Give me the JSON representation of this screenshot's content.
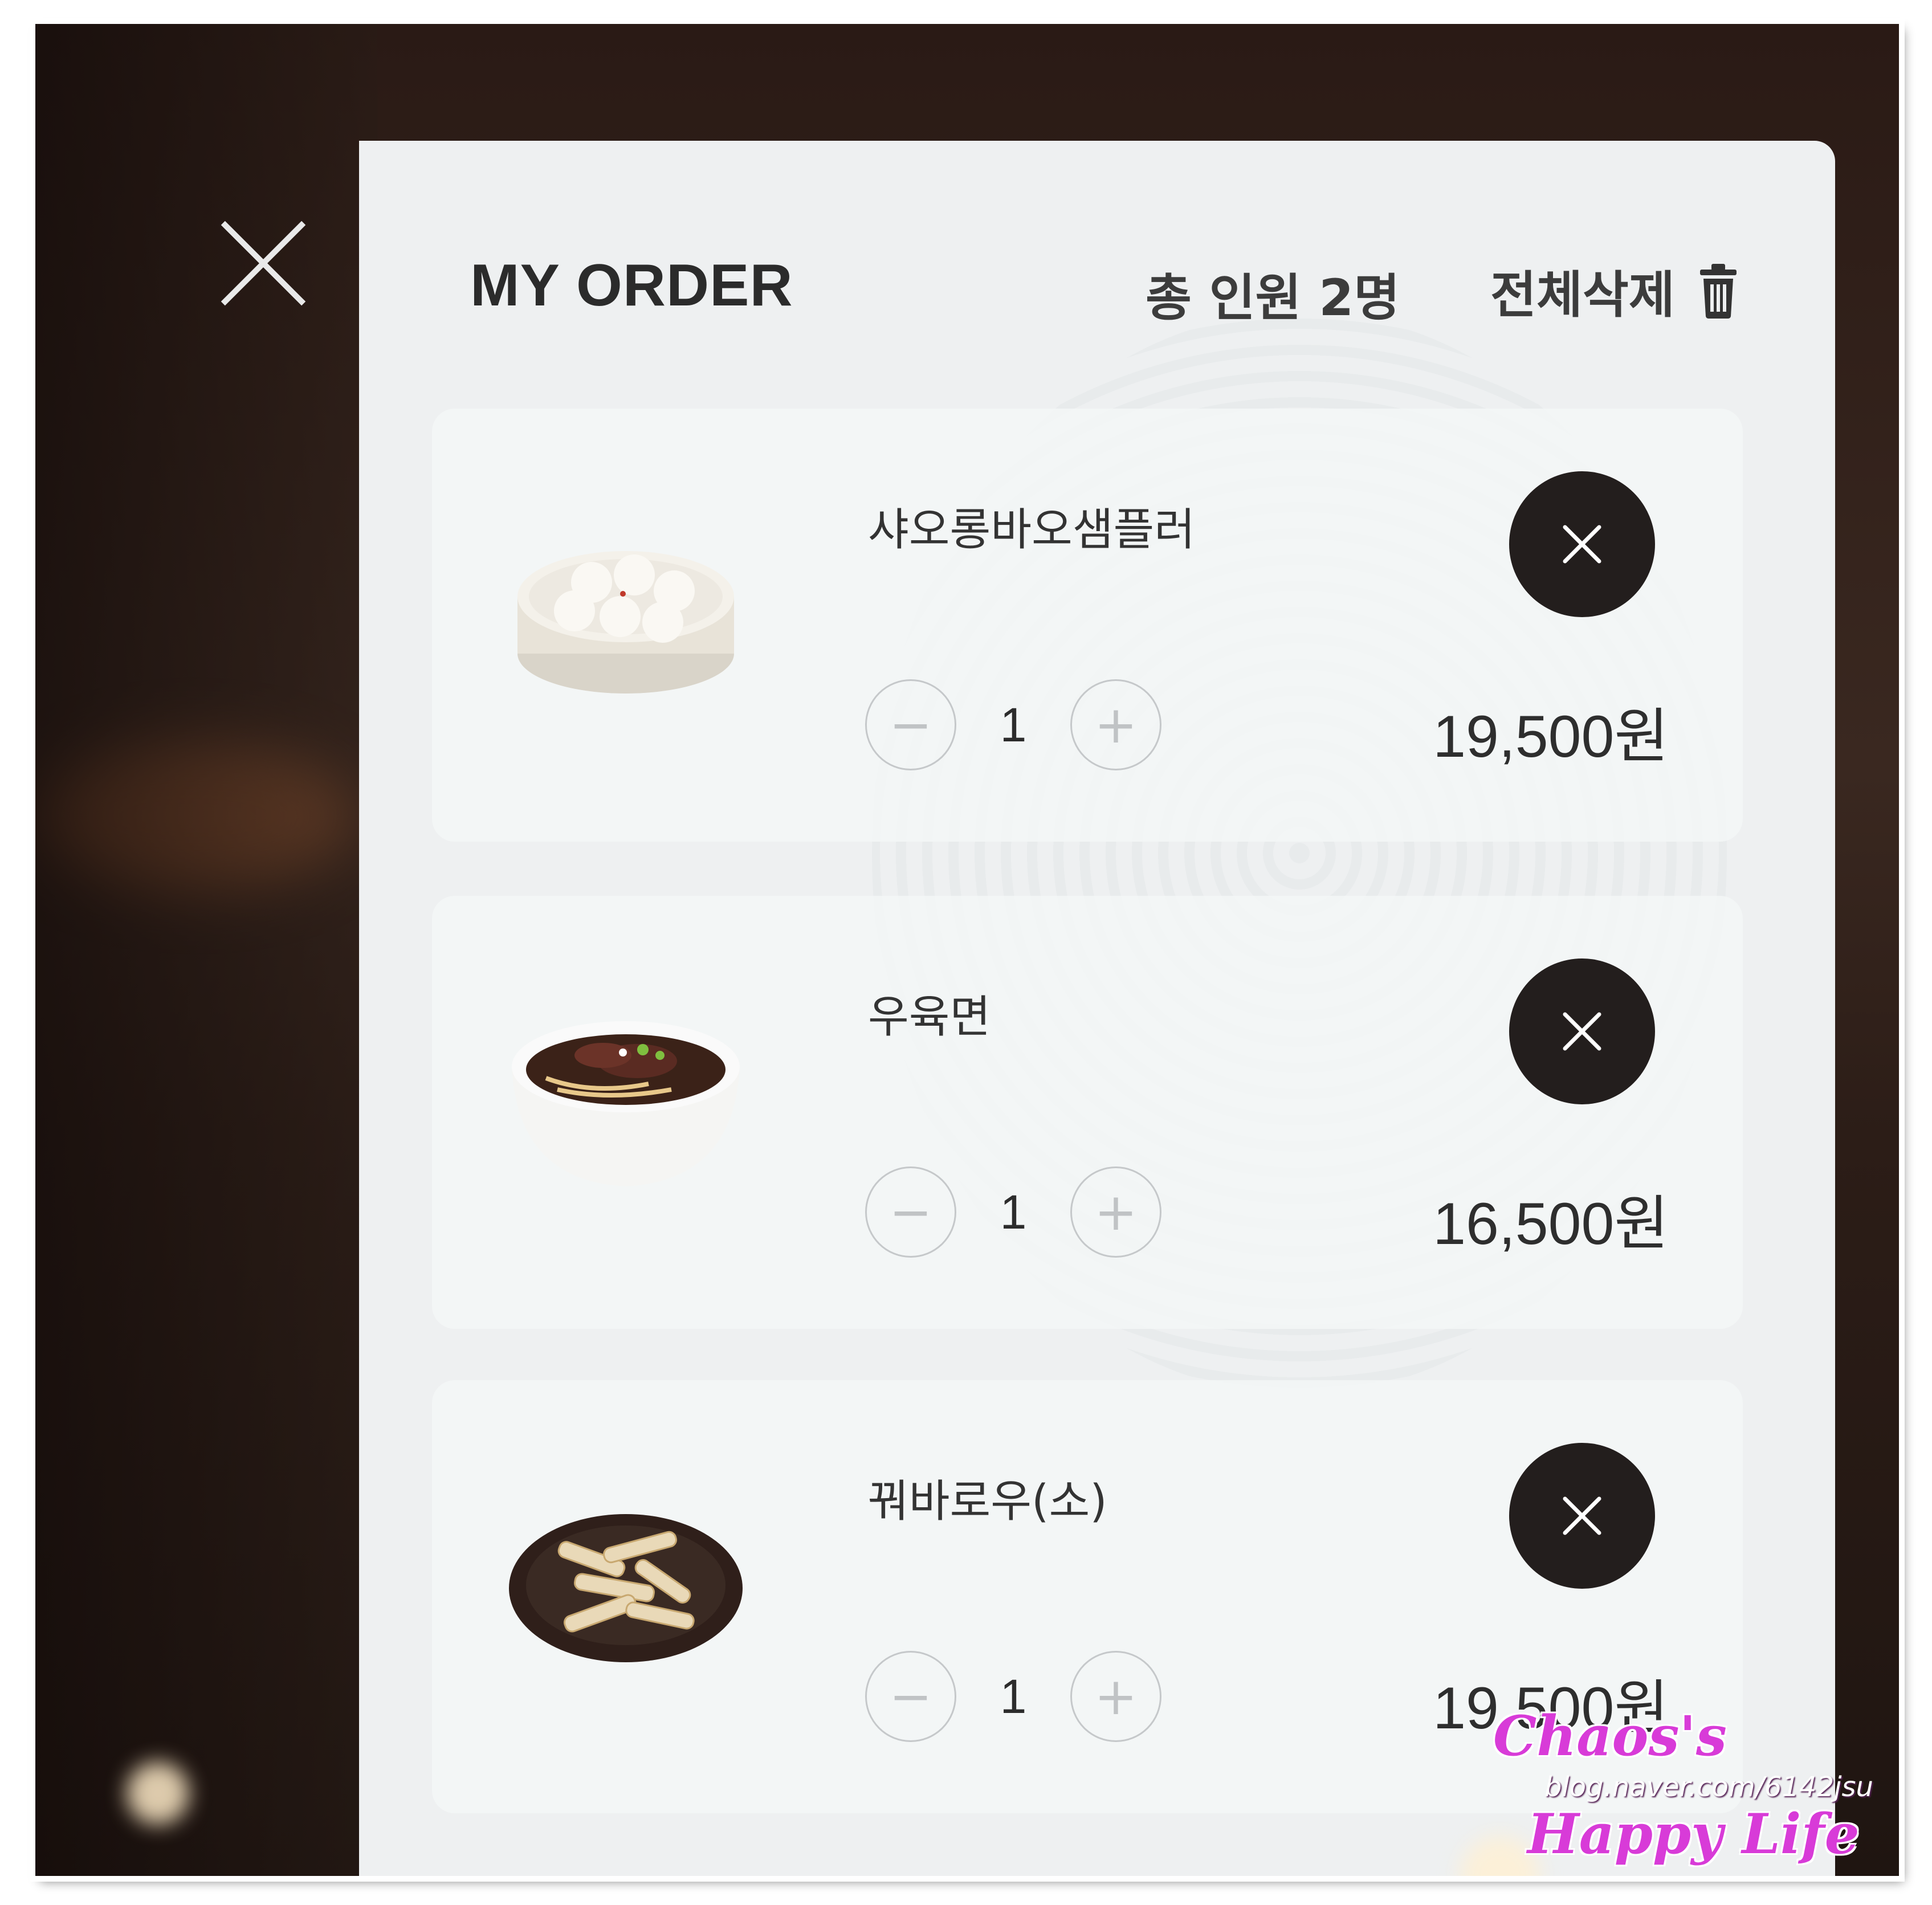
{
  "header": {
    "title": "MY ORDER",
    "headcount": "총 인원 2명",
    "delete_all_label": "전체삭제"
  },
  "items": [
    {
      "name": "샤오롱바오샘플러",
      "quantity": "1",
      "price": "19,500원",
      "image": "xiaolongbao-steamer"
    },
    {
      "name": "우육면",
      "quantity": "1",
      "price": "16,500원",
      "image": "beef-noodle-soup-bowl"
    },
    {
      "name": "꿔바로우(소)",
      "quantity": "1",
      "price": "19,500원",
      "image": "fried-pork-plate"
    }
  ],
  "controls": {
    "minus": "−",
    "plus": "+"
  },
  "watermark": {
    "line1": "Chaos's",
    "line2": "blog.naver.com/6142jsu",
    "line3": "Happy Life"
  },
  "colors": {
    "panel_bg": "#eef0f1",
    "remove_button": "#231e1d",
    "watermark": "#d83bd8"
  }
}
